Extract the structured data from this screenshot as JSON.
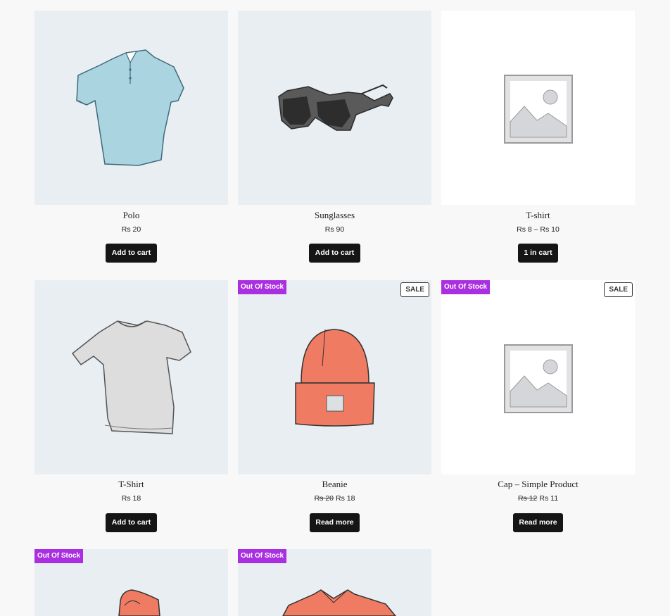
{
  "products": [
    {
      "title": "Polo",
      "price": "Rs 20",
      "button": "Add to cart",
      "image": "polo-shirt-image"
    },
    {
      "title": "Sunglasses",
      "price": "Rs 90",
      "button": "Add to cart",
      "image": "sunglasses-image"
    },
    {
      "title": "T-shirt",
      "price": "Rs 8 – Rs 10",
      "button": "1 in cart",
      "image": "placeholder-image"
    },
    {
      "title": "T-Shirt",
      "price": "Rs 18",
      "button": "Add to cart",
      "image": "tshirt-image"
    },
    {
      "title": "Beanie",
      "old_price": "Rs 20",
      "price": "Rs 18",
      "button": "Read more",
      "badge": "Out Of Stock",
      "sale": "SALE",
      "image": "beanie-image"
    },
    {
      "title": "Cap – Simple Product",
      "old_price": "Rs 12",
      "price": "Rs 11",
      "button": "Read more",
      "badge": "Out Of Stock",
      "sale": "SALE",
      "image": "placeholder-image"
    },
    {
      "badge": "Out Of Stock",
      "image": "hoodie-image"
    },
    {
      "badge": "Out Of Stock",
      "image": "long-sleeve-image"
    }
  ],
  "colors": {
    "badge_bg": "#a92fe0",
    "button_bg": "#151515",
    "image_bg": "#e9eef2"
  }
}
